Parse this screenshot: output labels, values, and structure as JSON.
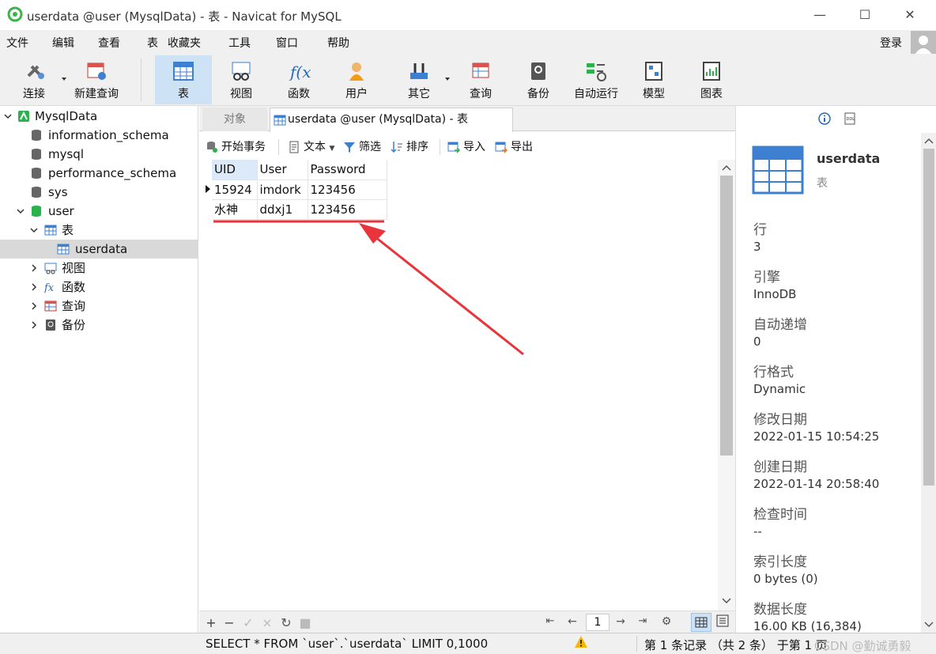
{
  "window": {
    "title": "userdata @user (MysqlData) - 表 - Navicat for MySQL",
    "minimize": "—",
    "maximize": "☐",
    "close": "✕"
  },
  "menu": [
    "文件",
    "编辑",
    "查看",
    "表",
    "收藏夹",
    "工具",
    "窗口",
    "帮助"
  ],
  "login": "登录",
  "toolbar": {
    "connect": "连接",
    "new_query": "新建查询",
    "table": "表",
    "view": "视图",
    "function": "函数",
    "user": "用户",
    "other": "其它",
    "query": "查询",
    "backup": "备份",
    "auto_run": "自动运行",
    "model": "模型",
    "chart": "图表"
  },
  "tree": {
    "connection": "MysqlData",
    "databases": [
      "information_schema",
      "mysql",
      "performance_schema",
      "sys",
      "user"
    ],
    "user_children": {
      "tables": "表",
      "table_item": "userdata",
      "views": "视图",
      "functions": "函数",
      "queries": "查询",
      "backups": "备份"
    }
  },
  "tabs": {
    "objects": "对象",
    "active": "userdata @user (MysqlData) - 表"
  },
  "subtoolbar": {
    "begin_tx": "开始事务",
    "text": "文本",
    "filter": "筛选",
    "sort": "排序",
    "import": "导入",
    "export": "导出"
  },
  "grid": {
    "columns": [
      "UID",
      "User",
      "Password"
    ],
    "rows": [
      [
        "15924",
        "imdork",
        "123456"
      ],
      [
        "水神",
        "ddxj1",
        "123456"
      ]
    ]
  },
  "pager": {
    "page": "1"
  },
  "status": {
    "sql": "SELECT * FROM `user`.`userdata` LIMIT 0,1000",
    "records": "第 1 条记录 （共 2 条） 于第 1 页",
    "watermark": "CSDN @勤诚勇毅"
  },
  "info": {
    "name": "userdata",
    "type": "表",
    "props": [
      {
        "label": "行",
        "value": "3"
      },
      {
        "label": "引擎",
        "value": "InnoDB"
      },
      {
        "label": "自动递增",
        "value": "0"
      },
      {
        "label": "行格式",
        "value": "Dynamic"
      },
      {
        "label": "修改日期",
        "value": "2022-01-15 10:54:25"
      },
      {
        "label": "创建日期",
        "value": "2022-01-14 20:58:40"
      },
      {
        "label": "检查时间",
        "value": "--"
      },
      {
        "label": "索引长度",
        "value": "0 bytes (0)"
      },
      {
        "label": "数据长度",
        "value": "16.00 KB (16,384)"
      }
    ]
  },
  "colors": {
    "accent": "#cde2f4",
    "annotation": "#e8343a",
    "db_green": "#2bb24c"
  }
}
